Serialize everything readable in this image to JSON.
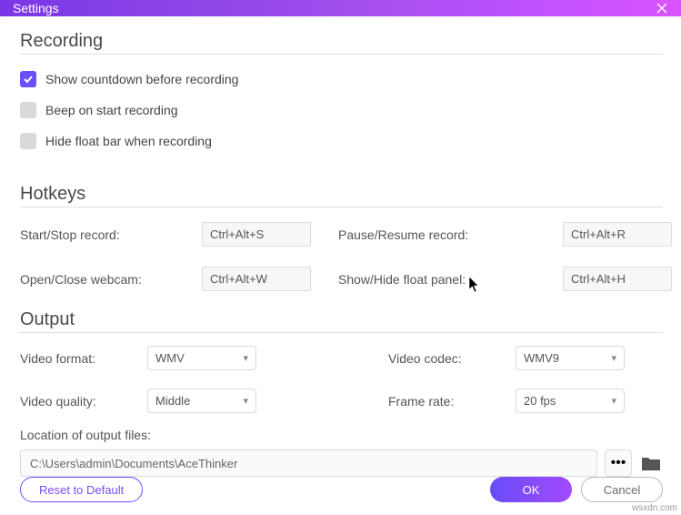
{
  "window": {
    "title": "Settings"
  },
  "sections": {
    "recording": {
      "heading": "Recording",
      "options": {
        "countdown": {
          "label": "Show countdown before recording",
          "checked": true
        },
        "beep": {
          "label": "Beep on start recording",
          "checked": false
        },
        "hidefloat": {
          "label": "Hide float bar when recording",
          "checked": false
        }
      }
    },
    "hotkeys": {
      "heading": "Hotkeys",
      "startstop": {
        "label": "Start/Stop record:",
        "value": "Ctrl+Alt+S"
      },
      "pauseresume": {
        "label": "Pause/Resume record:",
        "value": "Ctrl+Alt+R"
      },
      "webcam": {
        "label": "Open/Close webcam:",
        "value": "Ctrl+Alt+W"
      },
      "floatpanel": {
        "label": "Show/Hide float panel:",
        "value": "Ctrl+Alt+H"
      }
    },
    "output": {
      "heading": "Output",
      "format": {
        "label": "Video format:",
        "value": "WMV"
      },
      "codec": {
        "label": "Video codec:",
        "value": "WMV9"
      },
      "quality": {
        "label": "Video quality:",
        "value": "Middle"
      },
      "framerate": {
        "label": "Frame rate:",
        "value": "20 fps"
      },
      "location_label": "Location of output files:",
      "location_path": "C:\\Users\\admin\\Documents\\AceThinker",
      "browse_dots": "•••"
    }
  },
  "footer": {
    "reset": "Reset to Default",
    "ok": "OK",
    "cancel": "Cancel"
  },
  "watermark": "wsxdn.com"
}
